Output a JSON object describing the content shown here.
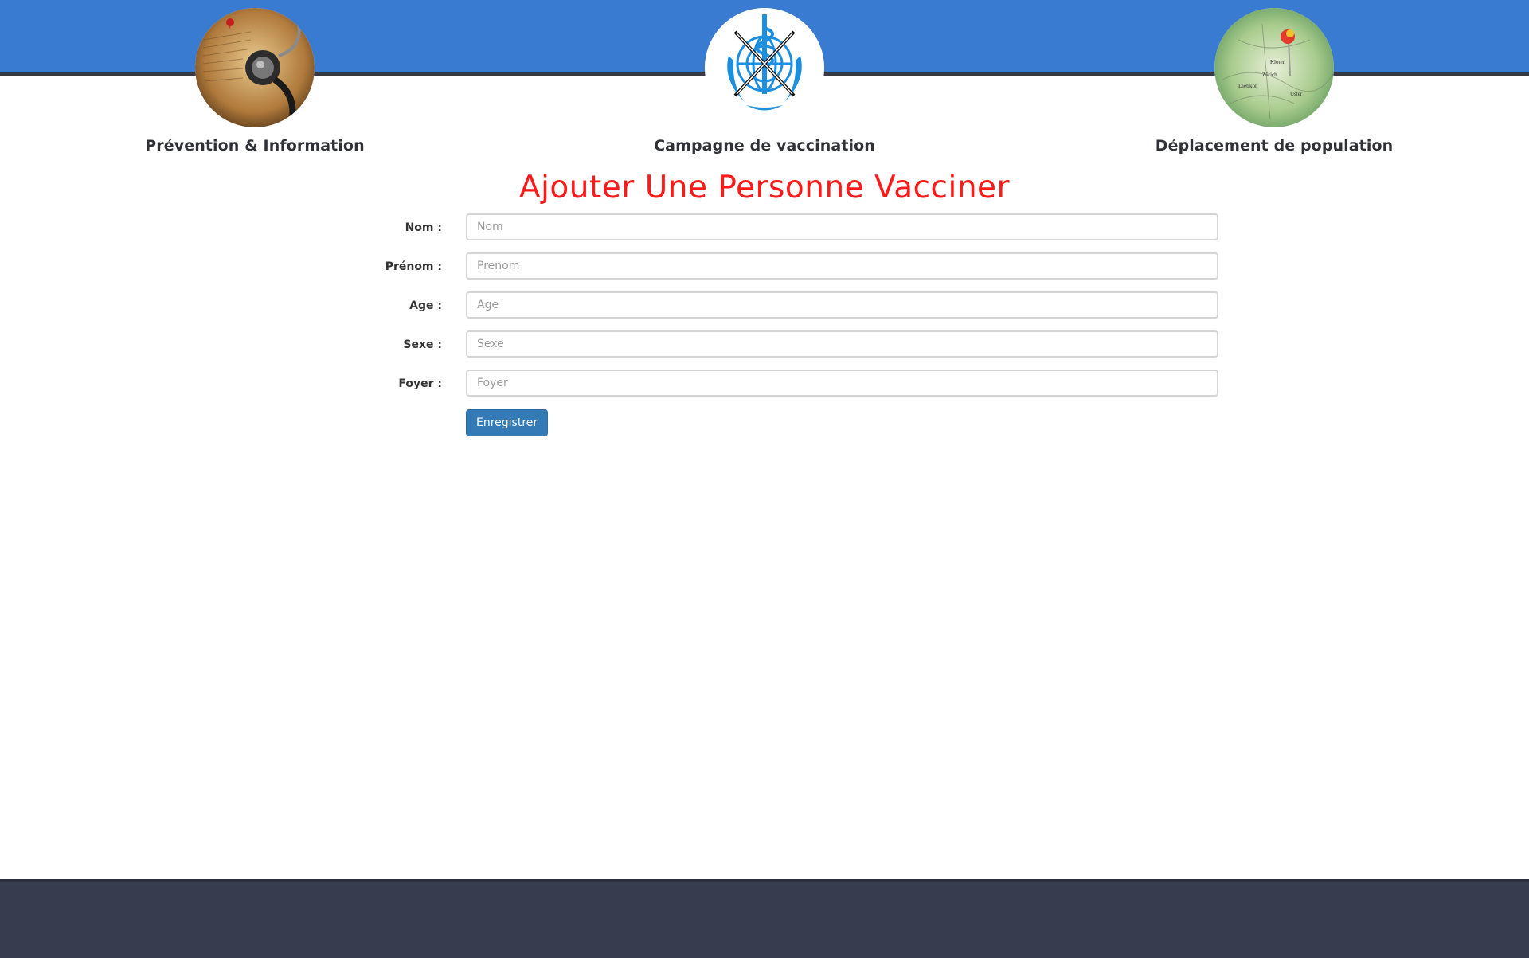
{
  "nav": {
    "items": [
      {
        "id": "prevention",
        "label": "Prévention & Information",
        "icon": "stethoscope-book-image"
      },
      {
        "id": "vaccination",
        "label": "Campagne de vaccination",
        "icon": "who-vaccination-logo"
      },
      {
        "id": "deplacement",
        "label": "Déplacement de population",
        "icon": "map-pin-image"
      }
    ]
  },
  "form": {
    "title": "Ajouter Une Personne Vacciner",
    "fields": [
      {
        "label": "Nom :",
        "placeholder": "Nom",
        "value": ""
      },
      {
        "label": "Prénom :",
        "placeholder": "Prenom",
        "value": ""
      },
      {
        "label": "Age :",
        "placeholder": "Age",
        "value": ""
      },
      {
        "label": "Sexe :",
        "placeholder": "Sexe",
        "value": ""
      },
      {
        "label": "Foyer :",
        "placeholder": "Foyer",
        "value": ""
      }
    ],
    "submit_label": "Enregistrer"
  },
  "colors": {
    "header": "#3a7bd2",
    "title": "#ff1a1a",
    "button": "#337ab7",
    "footer": "#373d4f"
  }
}
